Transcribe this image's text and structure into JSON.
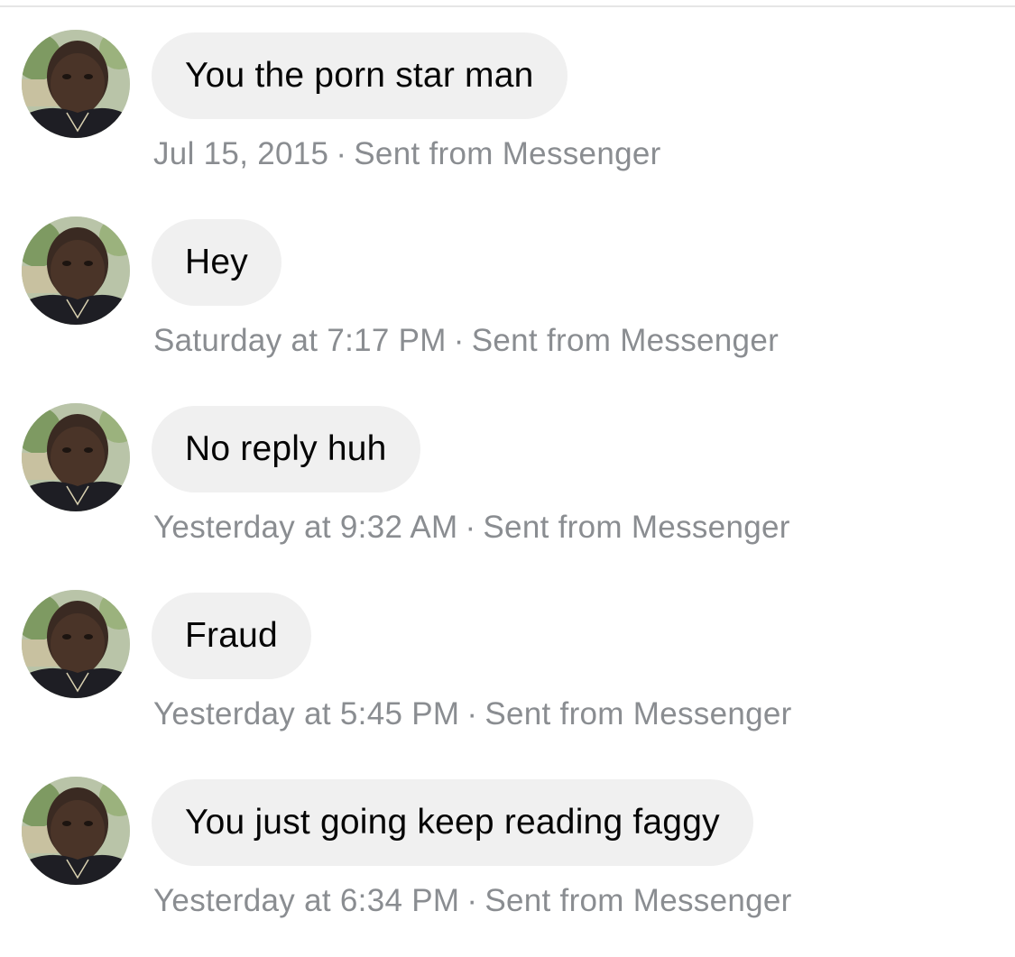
{
  "messages": [
    {
      "text": "You the porn star man",
      "time": "Jul 15, 2015",
      "source": "Sent from Messenger"
    },
    {
      "text": "Hey",
      "time": "Saturday at 7:17 PM",
      "source": "Sent from Messenger"
    },
    {
      "text": "No reply huh",
      "time": "Yesterday at 9:32 AM",
      "source": "Sent from Messenger"
    },
    {
      "text": "Fraud",
      "time": "Yesterday at 5:45 PM",
      "source": "Sent from Messenger"
    },
    {
      "text": "You just going keep reading faggy",
      "time": "Yesterday at 6:34 PM",
      "source": "Sent from Messenger"
    }
  ],
  "separator": "·",
  "colors": {
    "bubble": "#f0f0f0",
    "text": "#050505",
    "meta": "#8a8d91",
    "divider": "#e6e6e6"
  },
  "icons": {
    "avatar": "sender-avatar-photo"
  }
}
